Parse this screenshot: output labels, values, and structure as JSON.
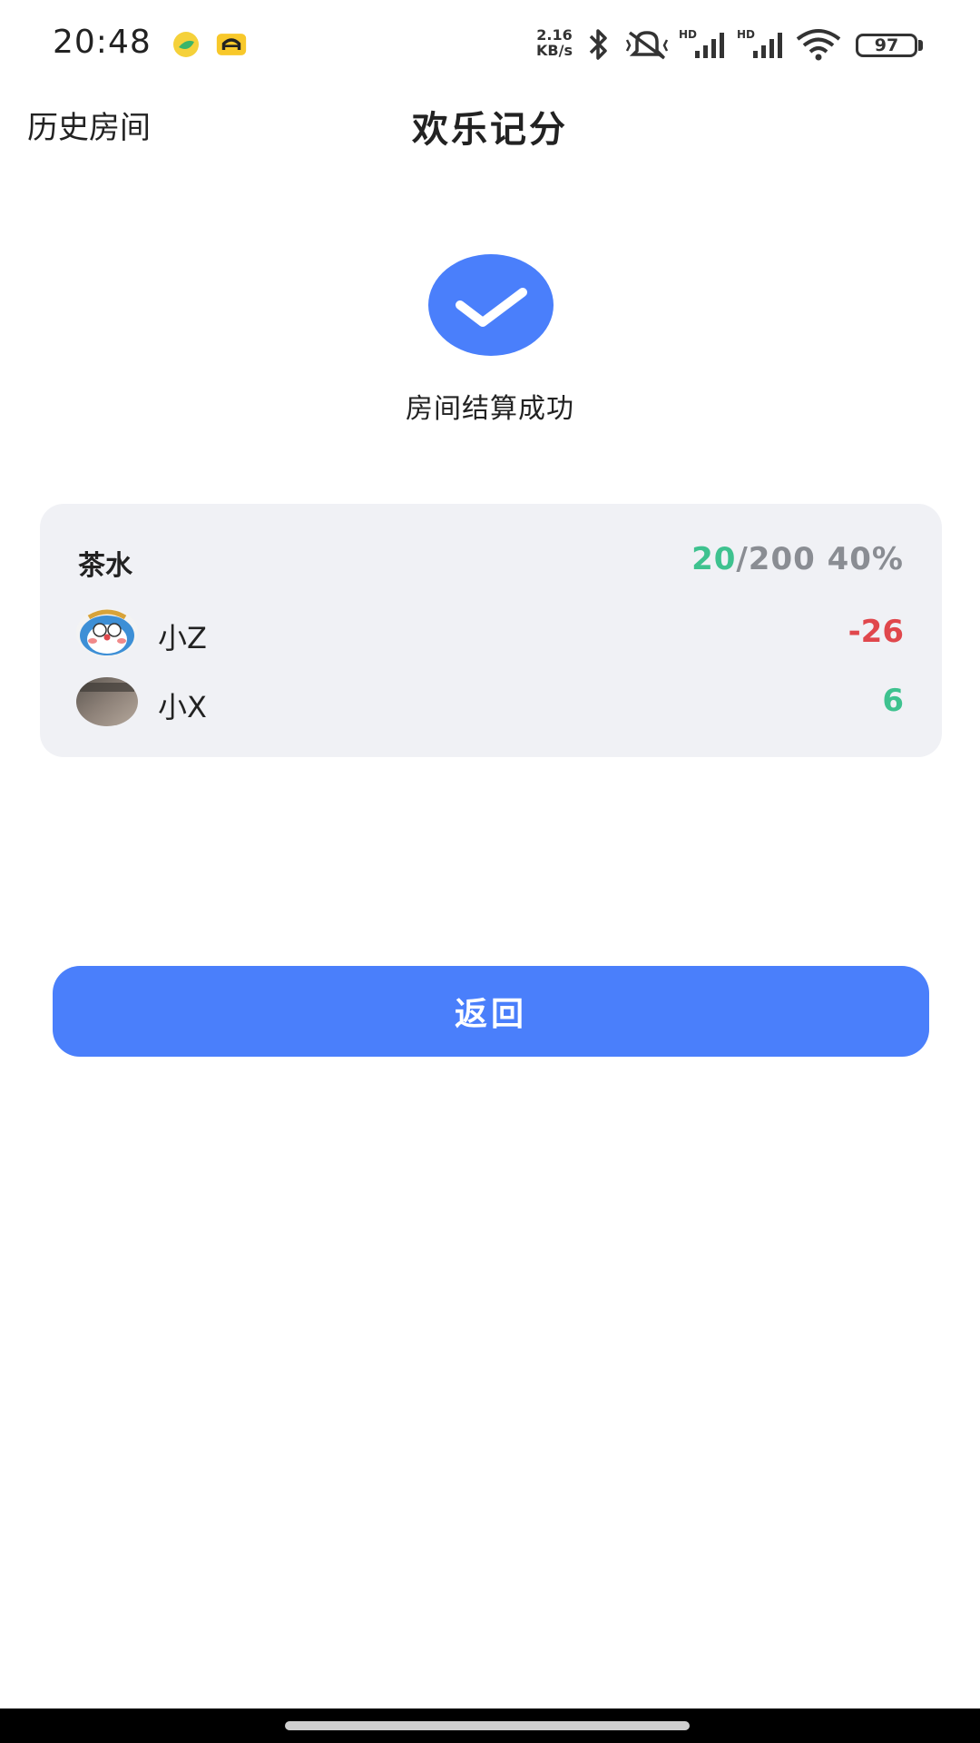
{
  "status_bar": {
    "time": "20:48",
    "net_speed_value": "2.16",
    "net_speed_unit": "KB/s",
    "battery": "97",
    "icons": [
      "music-app-icon",
      "car-app-icon",
      "bluetooth-icon",
      "mute-vibrate-icon",
      "hd-signal-icon",
      "hd-signal-icon",
      "wifi-icon",
      "battery-icon"
    ]
  },
  "nav": {
    "left_link": "历史房间",
    "title": "欢乐记分"
  },
  "success": {
    "icon": "check-icon",
    "message": "房间结算成功"
  },
  "card": {
    "title": "茶水",
    "stat_current": "20",
    "stat_rest": "/200 40%",
    "players": [
      {
        "name": "小Z",
        "score": "-26",
        "score_color": "#e0474c",
        "avatar": "cartoon-cat-avatar"
      },
      {
        "name": "小X",
        "score": "6",
        "score_color": "#3ec28f",
        "avatar": "photo-avatar"
      }
    ]
  },
  "actions": {
    "back_label": "返回"
  },
  "colors": {
    "accent": "#4a7ffb",
    "positive": "#3ec28f",
    "negative": "#e0474c",
    "card_bg": "#f0f1f5"
  }
}
